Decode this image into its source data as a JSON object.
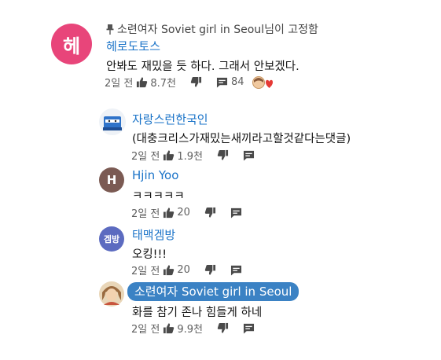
{
  "pinned": {
    "pin_label": "소련여자 Soviet girl in Seoul님이 고정함",
    "avatar_letter": "헤",
    "author": "헤로도토스",
    "text": "안봐도 재밌을 듯 하다. 그래서 안보겠다.",
    "timestamp": "2일 전",
    "likes": "8.7천",
    "replies": "84",
    "colors": {
      "avatar": "#e8457a",
      "heart": "#e53935"
    }
  },
  "replies": [
    {
      "author": "자랑스런한국인",
      "text": "(대충크리스가재밌는새끼라고할것같다는댓글)",
      "timestamp": "2일 전",
      "likes": "1.9천",
      "avatar_icon": "blue-box-character-icon"
    },
    {
      "author": "Hjin Yoo",
      "avatar_letter": "H",
      "text": "ㅋㅋㅋㅋㅋ",
      "timestamp": "2일 전",
      "likes": "20",
      "avatar_color": "#7b5a53"
    },
    {
      "author": "태맥겜방",
      "avatar_letter": "겜방",
      "text": "오킹!!!",
      "timestamp": "2일 전",
      "likes": "20",
      "avatar_color": "#5c6bc0"
    },
    {
      "author": "소련여자 Soviet girl in Seoul",
      "text": "화를 참기 존나 힘들게 하네",
      "timestamp": "2일 전",
      "likes": "9.9천",
      "avatar_icon": "creator-photo-icon",
      "badge_color": "#3b82c4"
    }
  ]
}
